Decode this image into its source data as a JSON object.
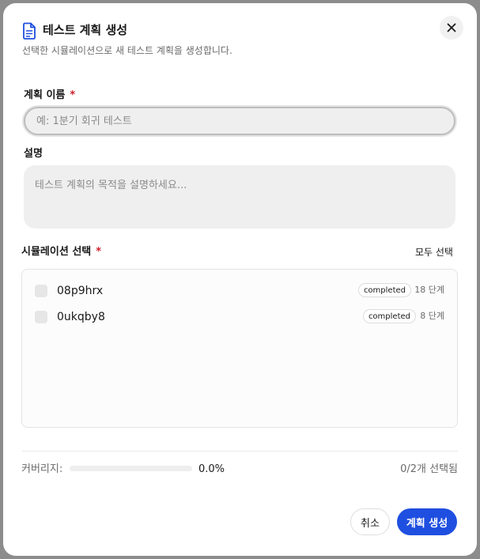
{
  "dialog": {
    "title": "테스트 계획 생성",
    "subtitle": "선택한 시뮬레이션으로 새 테스트 계획을 생성합니다.",
    "title_icon": "document-icon",
    "close_icon": "close-icon"
  },
  "form": {
    "name_label": "계획 이름",
    "required_mark": "*",
    "name_placeholder": "예: 1분기 회귀 테스트",
    "name_value": "",
    "description_label": "설명",
    "description_placeholder": "테스트 계획의 목적을 설명하세요...",
    "description_value": ""
  },
  "simulations": {
    "label": "시뮬레이션 선택",
    "select_all": "모두 선택",
    "items": [
      {
        "name": "08p9hrx",
        "status": "completed",
        "steps": "18 단계",
        "checked": false
      },
      {
        "name": "0ukqby8",
        "status": "completed",
        "steps": "8 단계",
        "checked": false
      }
    ]
  },
  "footer": {
    "coverage_label": "커버리지:",
    "coverage_value": "0.0%",
    "coverage_fraction": 0,
    "selected_count": "0/2개 선택됨",
    "cancel_label": "취소",
    "create_label": "계획 생성"
  },
  "colors": {
    "accent": "#1f4fe0",
    "required": "#d0202a"
  }
}
